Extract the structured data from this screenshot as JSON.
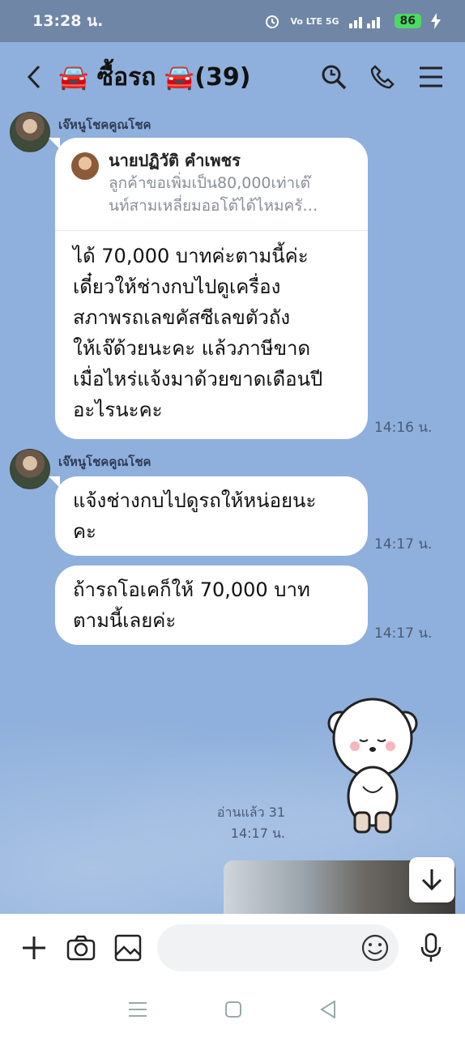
{
  "status_bar": {
    "time": "13:28 น.",
    "network_labels": "Vo LTE 5G",
    "battery": "86"
  },
  "header": {
    "title": "🚘 ซื้อรถ 🚘(39)"
  },
  "messages": [
    {
      "sender": "เจ๊หนูโชคคูณโชค",
      "reply": {
        "name": "นายปฏิวัติ คำเพชร",
        "text": "ลูกค้าขอเพิ่มเป็น80,000เท่าเต๊\nนท์สามเหลี่ยมออโต้ได้ไหมครั…"
      },
      "text": "ได้ 70,000 บาทค่ะตามนี้ค่ะ\nเดี๋ยวให้ช่างกบไปดูเครื่อง\nสภาพรถเลขคัสซีเลขตัวถัง\nให้เจ๊ด้วยนะคะ แล้วภาษีขาด\nเมื่อไหร่แจ้งมาด้วยขาดเดือนปี\nอะไรนะคะ",
      "time": "14:16 น."
    },
    {
      "sender": "เจ๊หนูโชคคูณโชค",
      "text": "แจ้งช่างกบไปดูรถให้หน่อยนะ\nคะ",
      "time": "14:17 น."
    },
    {
      "text": "ถ้ารถโอเคก็ให้ 70,000 บาท\nตามนี้เลยค่ะ",
      "time": "14:17 น."
    }
  ],
  "sticker_receipt": {
    "read": "อ่านแล้ว 31",
    "time": "14:17 น."
  },
  "input": {
    "placeholder": ""
  },
  "icons": [
    "back-icon",
    "search-icon",
    "phone-icon",
    "menu-icon",
    "scroll-down-icon",
    "plus-icon",
    "camera-icon",
    "image-icon",
    "emoji-icon",
    "mic-icon"
  ]
}
